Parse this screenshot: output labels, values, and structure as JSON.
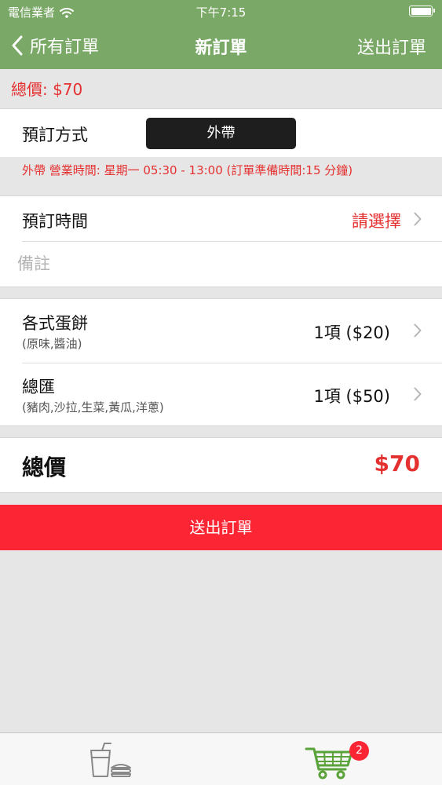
{
  "status_bar": {
    "carrier": "電信業者",
    "time": "下午7:15"
  },
  "nav": {
    "back_label": "所有訂單",
    "title": "新訂單",
    "submit_label": "送出訂單"
  },
  "total_banner": "總價: $70",
  "order_method": {
    "label": "預訂方式",
    "selected": "外帶"
  },
  "hours_note": "外帶 營業時間: 星期一 05:30 - 13:00 (訂單準備時間:15 分鐘)",
  "order_time": {
    "label": "預訂時間",
    "value": "請選擇"
  },
  "notes": {
    "placeholder": "備註",
    "value": ""
  },
  "items": [
    {
      "name": "各式蛋餅",
      "options": "(原味,醬油)",
      "qty": "1項 ($20)"
    },
    {
      "name": "總匯",
      "options": "(豬肉,沙拉,生菜,黃瓜,洋蔥)",
      "qty": "1項 ($50)"
    }
  ],
  "total": {
    "label": "總價",
    "value": "$70"
  },
  "submit_button": "送出訂單",
  "tab_bar": {
    "cart_badge": "2"
  },
  "colors": {
    "nav_green": "#7aa866",
    "accent_red": "#e53030",
    "button_red": "#fc2533",
    "cart_green": "#5aa23a"
  },
  "icons": [
    "wifi-icon",
    "battery-icon",
    "back-chevron-icon",
    "chevron-right-icon",
    "food-menu-icon",
    "shopping-cart-icon"
  ]
}
